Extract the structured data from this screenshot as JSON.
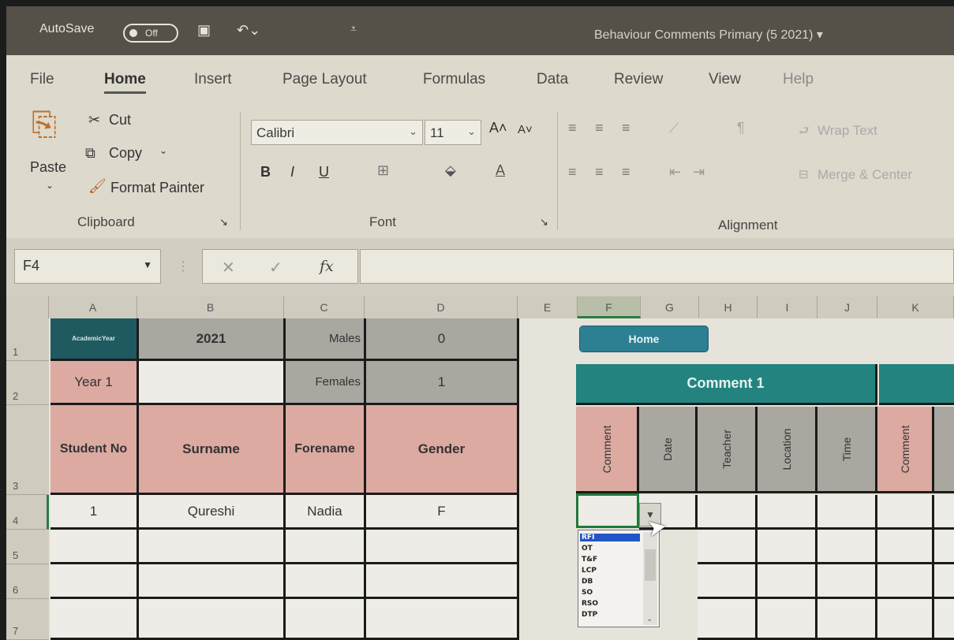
{
  "titlebar": {
    "autosave_label": "AutoSave",
    "autosave_state": "Off",
    "document_title": "Behaviour Comments Primary (5 2021) ▾"
  },
  "ribbon": {
    "tabs": [
      "File",
      "Home",
      "Insert",
      "Page Layout",
      "Formulas",
      "Data",
      "Review",
      "View",
      "Help"
    ],
    "active_tab": "Home",
    "clipboard": {
      "paste": "Paste",
      "cut": "Cut",
      "copy": "Copy",
      "format_painter": "Format Painter",
      "group": "Clipboard"
    },
    "font": {
      "name": "Calibri",
      "size": "11",
      "group": "Font",
      "bold": "B",
      "italic": "I",
      "underline": "U"
    },
    "alignment": {
      "wrap_text": "Wrap Text",
      "merge_center": "Merge & Center",
      "group": "Alignment"
    }
  },
  "formula_bar": {
    "name_box": "F4",
    "fx": "fx",
    "cancel": "✕",
    "enter": "✓"
  },
  "grid": {
    "columns": [
      "A",
      "B",
      "C",
      "D",
      "E",
      "F",
      "G",
      "H",
      "I",
      "J",
      "K"
    ],
    "rows": [
      "1",
      "2",
      "3",
      "4",
      "5",
      "6",
      "7"
    ],
    "r1": {
      "academic_year_label": "AcademicYear",
      "year_value": "2021",
      "males_label": "Males",
      "males_value": "0"
    },
    "r2": {
      "year_group": "Year 1",
      "females_label": "Females",
      "females_value": "1"
    },
    "headers": {
      "student_no": "Student No",
      "surname": "Surname",
      "forename": "Forename",
      "gender": "Gender"
    },
    "student": {
      "no": "1",
      "surname": "Qureshi",
      "forename": "Nadia",
      "gender": "F"
    },
    "home_button": "Home",
    "comment_group": "Comment 1",
    "comment_fields": [
      "Comment",
      "Date",
      "Teacher",
      "Location",
      "Time",
      "Comment"
    ],
    "dropdown_options": [
      "RFI",
      "OT",
      "T&F",
      "LCP",
      "DB",
      "SO",
      "RSO",
      "DTP"
    ],
    "dropdown_selected": "RFI"
  },
  "colors": {
    "teal_header": "#23847f",
    "teal_button": "#2d7f92",
    "pink_header": "#dcaaa1",
    "gray_cell": "#a9a7a0",
    "active_border": "#1f7a3a"
  }
}
